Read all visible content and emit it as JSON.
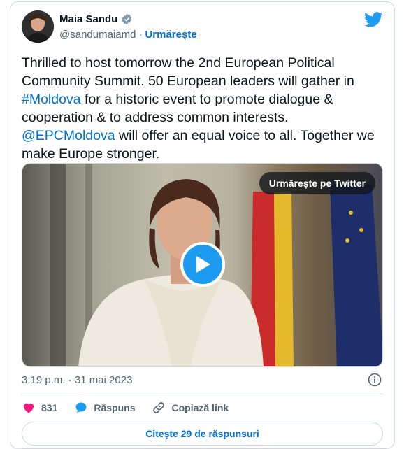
{
  "author": {
    "name": "Maia Sandu",
    "handle": "@sandumaiamd",
    "separator": "·",
    "follow_label": "Urmărește"
  },
  "tweet": {
    "text_1": "Thrilled to host tomorrow the 2nd European Political Community Summit. 50 European leaders will gather in ",
    "hashtag": "#Moldova",
    "text_2": " for a historic event to promote dialogue & cooperation & to address common interests. ",
    "mention": "@EPCMoldova",
    "text_3": " will offer an equal voice to all. Together we make Europe stronger."
  },
  "media": {
    "watch_label": "Urmărește pe Twitter"
  },
  "meta": {
    "timestamp": "3:19 p.m. · 31 mai 2023"
  },
  "actions": {
    "likes": "831",
    "reply_label": "Răspuns",
    "copy_label": "Copiază link"
  },
  "replies_button": "Citește 29 de răspunsuri",
  "colors": {
    "accent": "#1d9bf0",
    "link": "#006fd6",
    "like": "#f91880"
  }
}
